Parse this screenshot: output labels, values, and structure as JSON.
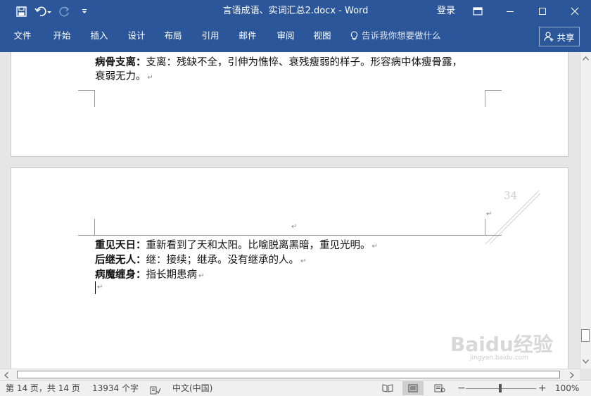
{
  "titlebar": {
    "title": "言语成语、实词汇总2.docx - Word",
    "login": "登录",
    "bg_color": "#2b579a"
  },
  "qat": {
    "icons": [
      "save-icon",
      "undo-icon",
      "redo-icon",
      "customize-icon"
    ]
  },
  "ribbon": {
    "tabs": [
      "文件",
      "开始",
      "插入",
      "设计",
      "布局",
      "引用",
      "邮件",
      "审阅",
      "视图"
    ],
    "tell_me": "告诉我你想要做什么",
    "share": "共享"
  },
  "document": {
    "page1": {
      "line1_term": "病骨支离：",
      "line1_text": "支离：残缺不全，引伸为憔悴、衰残瘦弱的样子。形容病中体瘦骨露，",
      "line2_text": "衰弱无力。"
    },
    "page2": {
      "page_number": "34",
      "entries": [
        {
          "term": "重见天日：",
          "text": "重新看到了天和太阳。比喻脱离黑暗，重见光明。"
        },
        {
          "term": "后继无人：",
          "text": "继：接续；继承。没有继承的人。"
        },
        {
          "term": "病魔缠身：",
          "text": "指长期患病"
        }
      ]
    },
    "paragraph_mark": "↵"
  },
  "statusbar": {
    "page_info": "第 14 页，共 14 页",
    "word_count": "13934 个字",
    "language": "中文(中国)",
    "zoom": "100%",
    "zoom_minus": "−",
    "zoom_plus": "+"
  },
  "watermark": {
    "text": "Baidu经验",
    "sub": "jingyan.baidu.com"
  }
}
